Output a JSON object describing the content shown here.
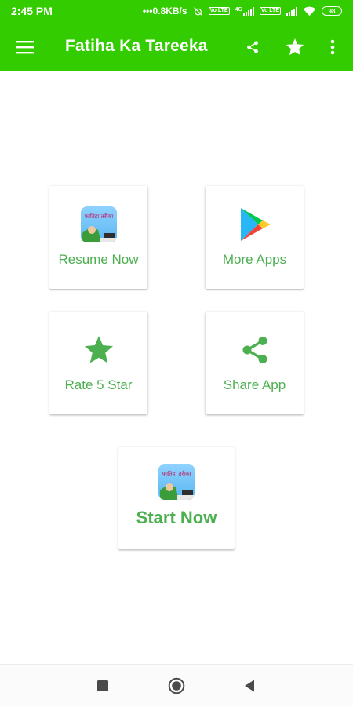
{
  "status_bar": {
    "time": "2:45 PM",
    "network_speed": "0.8KB/s",
    "network_type": "4G",
    "volte": "Vo LTE",
    "battery": "98"
  },
  "app_bar": {
    "title": "Fatiha Ka Tareeka",
    "icons": [
      "menu-icon",
      "share-icon",
      "star-icon",
      "more-vert-icon"
    ],
    "background": "#33cc00"
  },
  "cards": {
    "resume": {
      "label": "Resume Now",
      "icon": "app-icon"
    },
    "more_apps": {
      "label": "More Apps",
      "icon": "play-store-icon"
    },
    "rate": {
      "label": "Rate 5 Star",
      "icon": "star-icon"
    },
    "share": {
      "label": "Share App",
      "icon": "share-icon"
    },
    "start": {
      "label": "Start Now",
      "icon": "app-icon"
    }
  },
  "app_icon_text": "फातिहा तरीका",
  "accent_color": "#4caf50",
  "nav_bar": {
    "icons": [
      "recents-icon",
      "home-icon",
      "back-icon"
    ]
  }
}
